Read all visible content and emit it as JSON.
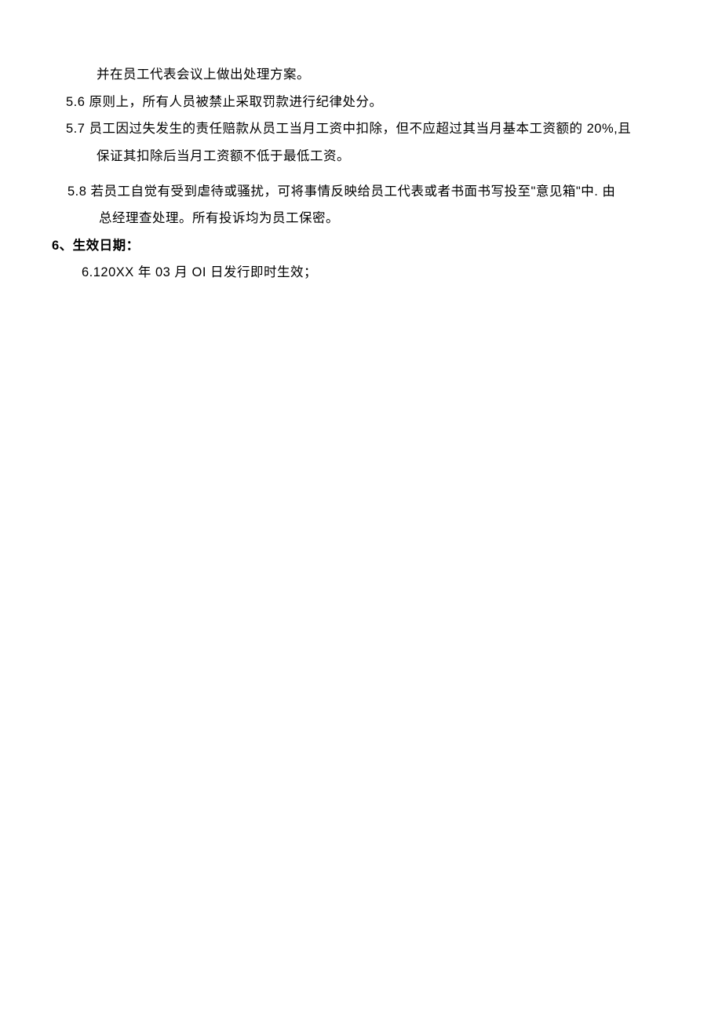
{
  "body": {
    "line1": "并在员工代表会议上做出处理方案。",
    "item56": "5.6  原则上，所有人员被禁止采取罚款进行纪律处分。",
    "item57a": "5.7 员工因过失发生的责任赔款从员工当月工资中扣除，但不应超过其当月基本工资额的 20%,且",
    "item57b": "保证其扣除后当月工资额不低于最低工资。",
    "item58a": "5.8 若员工自觉有受到虐待或骚扰，可将事情反映给员工代表或者书面书写投至\"意见箱\"中. 由",
    "item58b": "总经理查处理。所有投诉均为员工保密。",
    "heading6": "6、生效日期：",
    "item61": "6.120XX 年 03 月 OI 日发行即时生效；"
  }
}
